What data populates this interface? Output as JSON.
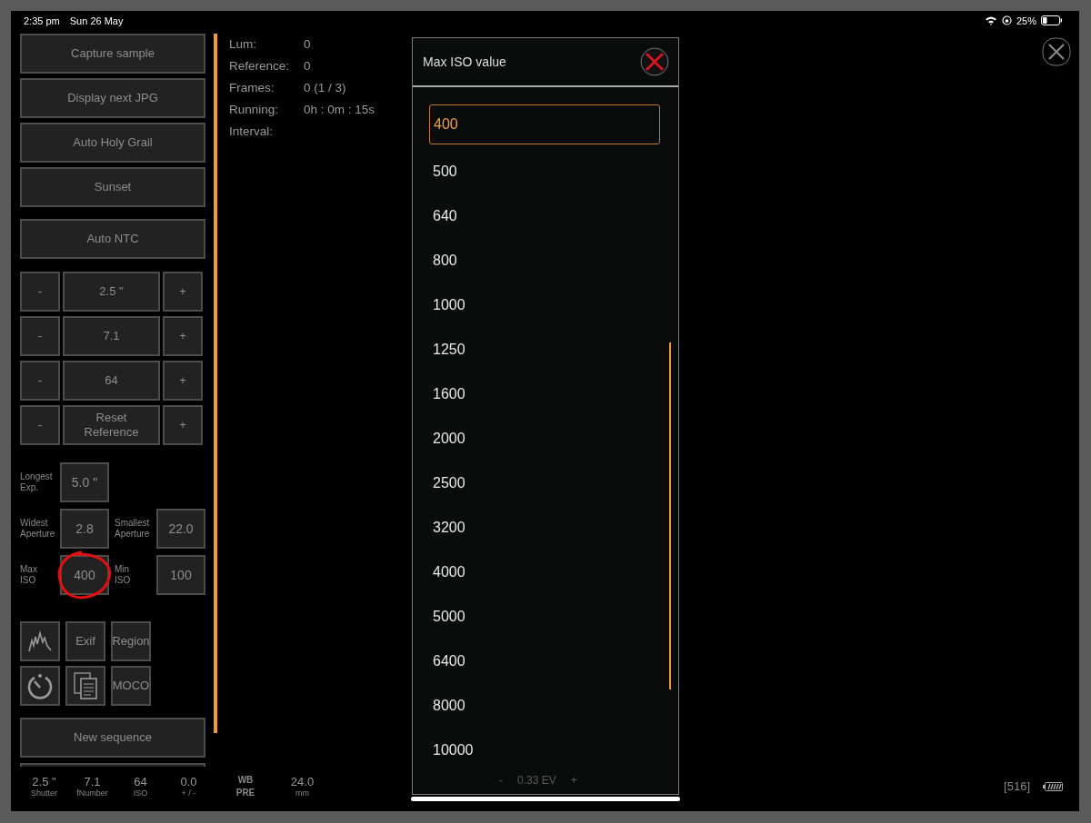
{
  "status_bar": {
    "time": "2:35 pm",
    "date": "Sun 26 May",
    "battery_percent": "25%"
  },
  "sidebar": {
    "actions": [
      "Capture sample",
      "Display next JPG",
      "Auto Holy Grail",
      "Sunset"
    ],
    "auto_ntc": "Auto NTC",
    "steppers": [
      {
        "minus": "-",
        "value": "2.5 \"",
        "plus": "+"
      },
      {
        "minus": "-",
        "value": "7.1",
        "plus": "+"
      },
      {
        "minus": "-",
        "value": "64",
        "plus": "+"
      },
      {
        "minus": "-",
        "value": "Reset\nReference",
        "plus": "+"
      }
    ],
    "limits": [
      [
        {
          "label": "Longest\nExp.",
          "value": "5.0 \""
        }
      ],
      [
        {
          "label": "Widest\nAperture",
          "value": "2.8"
        },
        {
          "label": "Smallest\nAperture",
          "value": "22.0"
        }
      ],
      [
        {
          "label": "Max\nISO",
          "value": "400",
          "annotated": true
        },
        {
          "label": "Min\nISO",
          "value": "100",
          "annotated": false
        }
      ]
    ],
    "tools": [
      {
        "kind": "histogram"
      },
      {
        "kind": "text",
        "label": "Exif"
      },
      {
        "kind": "text",
        "label": "Region"
      },
      {
        "kind": "timer"
      },
      {
        "kind": "copy"
      },
      {
        "kind": "text",
        "label": "MOCO"
      }
    ],
    "new_sequence": "New sequence"
  },
  "info": [
    {
      "label": "Lum:",
      "value": "0"
    },
    {
      "label": "Reference:",
      "value": "0"
    },
    {
      "label": "Frames:",
      "value": "0  (1 / 3)"
    },
    {
      "label": "Running:",
      "value": "0h : 0m : 15s"
    },
    {
      "label": "Interval:"
    }
  ],
  "dialog": {
    "title": "Max ISO value",
    "options": [
      {
        "label": "400",
        "selected": true
      },
      {
        "label": "500",
        "selected": false
      },
      {
        "label": "640",
        "selected": false
      },
      {
        "label": "800",
        "selected": false
      },
      {
        "label": "1000",
        "selected": false
      },
      {
        "label": "1250",
        "selected": false
      },
      {
        "label": "1600",
        "selected": false
      },
      {
        "label": "2000",
        "selected": false
      },
      {
        "label": "2500",
        "selected": false
      },
      {
        "label": "3200",
        "selected": false
      },
      {
        "label": "4000",
        "selected": false
      },
      {
        "label": "5000",
        "selected": false
      },
      {
        "label": "6400",
        "selected": false
      },
      {
        "label": "8000",
        "selected": false
      },
      {
        "label": "10000",
        "selected": false
      }
    ],
    "behind": {
      "minus": "-",
      "value": "0.33 EV",
      "plus": "+"
    }
  },
  "readouts": [
    {
      "value": "2.5 \"",
      "label": "Shutter"
    },
    {
      "value": "7.1",
      "label": "fNumber"
    },
    {
      "value": "64",
      "label": "ISO"
    },
    {
      "value": "0.0",
      "label": "+ / -"
    }
  ],
  "white_balance": {
    "label": "WB",
    "value": "PRE"
  },
  "focal_length": {
    "value": "24.0",
    "label": "mm"
  },
  "frame_counter": "[516]"
}
